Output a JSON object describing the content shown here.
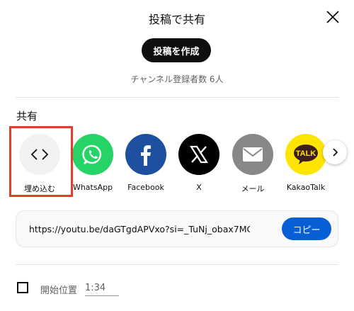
{
  "dialog": {
    "title": "投稿で共有",
    "post_button": "投稿を作成",
    "subscribers": "チャンネル登録者数 6人",
    "close_icon": "close-icon"
  },
  "share": {
    "label": "共有",
    "items": [
      {
        "label": "埋め込む",
        "icon": "embed-code-icon",
        "color": "#f2f2f2"
      },
      {
        "label": "WhatsApp",
        "icon": "whatsapp-icon",
        "color": "#25d366"
      },
      {
        "label": "Facebook",
        "icon": "facebook-icon",
        "color": "#1877f2"
      },
      {
        "label": "X",
        "icon": "x-icon",
        "color": "#000000"
      },
      {
        "label": "メール",
        "icon": "mail-icon",
        "color": "#888888"
      },
      {
        "label": "KakaoTalk",
        "icon": "kakaotalk-icon",
        "color": "#fee500"
      }
    ],
    "next_icon": "chevron-right-icon",
    "kakao_badge": "TALK"
  },
  "link": {
    "url": "https://youtu.be/daGTgdAPVxo?si=_TuNj_obax7MC",
    "copy_button": "コピー"
  },
  "start_at": {
    "label": "開始位置",
    "time": "1:34",
    "checked": false
  },
  "colors": {
    "accent": "#065fd4",
    "highlight": "#e0402a"
  }
}
